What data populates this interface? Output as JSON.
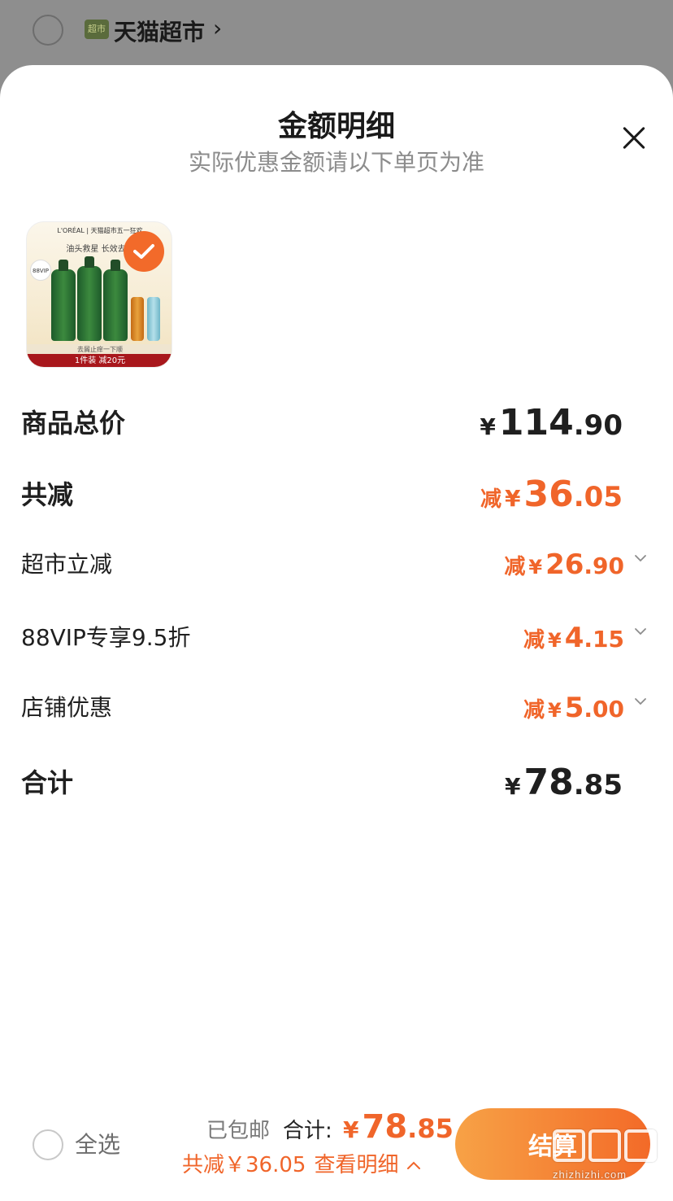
{
  "store": {
    "logo_text": "超市",
    "name": "天猫超市",
    "chevron": "›"
  },
  "sheet": {
    "title": "金额明细",
    "subtitle": "实际优惠金额请以下单页为准"
  },
  "product": {
    "brand_line": "L'ORÉAL | 天猫超市五一狂欢",
    "tagline": "油头救星 长效去油",
    "vip_badge": "88VIP",
    "strip_text": "去屑止痒一下顺",
    "promo": "1件装 减20元",
    "selected": true
  },
  "rows": {
    "goods_total": {
      "label": "商品总价",
      "yen": "¥",
      "int": "114",
      "dec": ".90"
    },
    "total_discount": {
      "label": "共减",
      "prefix": "减",
      "yen": "¥",
      "int": "36",
      "dec": ".05"
    },
    "supermarket_discount": {
      "label": "超市立减",
      "prefix": "减",
      "yen": "¥",
      "int": "26",
      "dec": ".90"
    },
    "vip_discount": {
      "label": "88VIP专享9.5折",
      "prefix": "减",
      "yen": "¥",
      "int": "4",
      "dec": ".15"
    },
    "store_discount": {
      "label": "店铺优惠",
      "prefix": "减",
      "yen": "¥",
      "int": "5",
      "dec": ".00"
    },
    "grand_total": {
      "label": "合计",
      "yen": "¥",
      "int": "78",
      "dec": ".85"
    }
  },
  "bottom_bar": {
    "select_all": "全选",
    "shipping": "已包邮",
    "total_label": "合计:",
    "total_yen": "¥",
    "total_int": "78",
    "total_dec": ".85",
    "savings": "共减￥36.05",
    "view_details": "查看明细",
    "checkout": "结算"
  },
  "watermark": {
    "text": "zhizhizhi.com"
  },
  "colors": {
    "accent": "#f0652a",
    "button_start": "#f7a246",
    "button_end": "#f36a28",
    "overlay": "#8e8e8e"
  }
}
